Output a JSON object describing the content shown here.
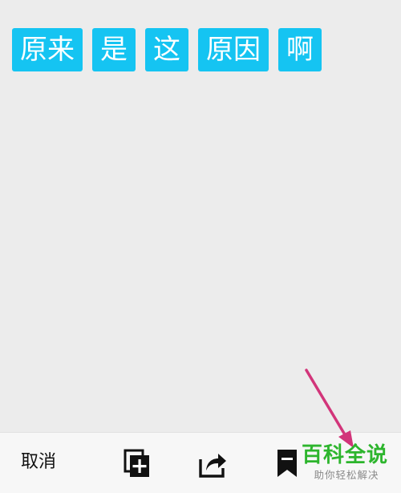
{
  "chips": [
    "原来",
    "是",
    "这",
    "原因",
    "啊"
  ],
  "toolbar": {
    "cancel_label": "取消",
    "icons": [
      "copy-plus-icon",
      "share-icon",
      "bookmark-icon"
    ]
  },
  "watermark": {
    "title": "百科全说",
    "subtitle": "助你轻松解决"
  },
  "colors": {
    "chip_bg": "#15c4f2",
    "chip_text": "#ffffff",
    "arrow": "#d2357a",
    "watermark_green": "#2db52d"
  }
}
